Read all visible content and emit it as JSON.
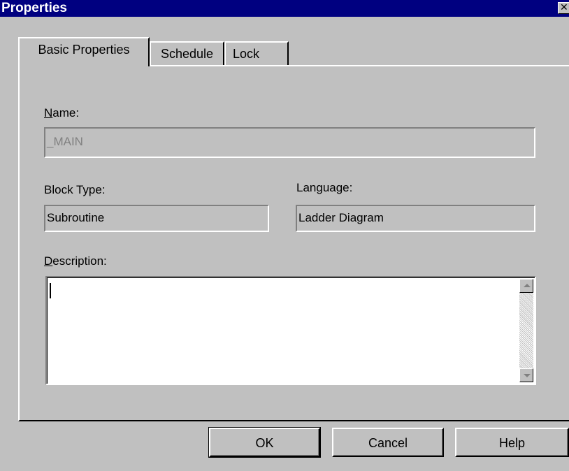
{
  "window": {
    "title": "Properties",
    "close_glyph": "✕",
    "close_icon": "close-icon"
  },
  "tabs": [
    {
      "label": "Basic Properties",
      "active": true
    },
    {
      "label": "Schedule",
      "active": false
    },
    {
      "label": "Lock",
      "active": false
    }
  ],
  "form": {
    "name_label_mnemonic": "N",
    "name_label_rest": "ame:",
    "name_value": "_MAIN",
    "block_type_label": "Block Type:",
    "block_type_value": "Subroutine",
    "language_label": "Language:",
    "language_value": "Ladder Diagram",
    "description_label_mnemonic": "D",
    "description_label_rest": "escription:",
    "description_value": ""
  },
  "buttons": {
    "ok": "OK",
    "cancel": "Cancel",
    "help": "Help"
  },
  "colors": {
    "titlebar": "#000080",
    "face": "#c0c0c0"
  }
}
